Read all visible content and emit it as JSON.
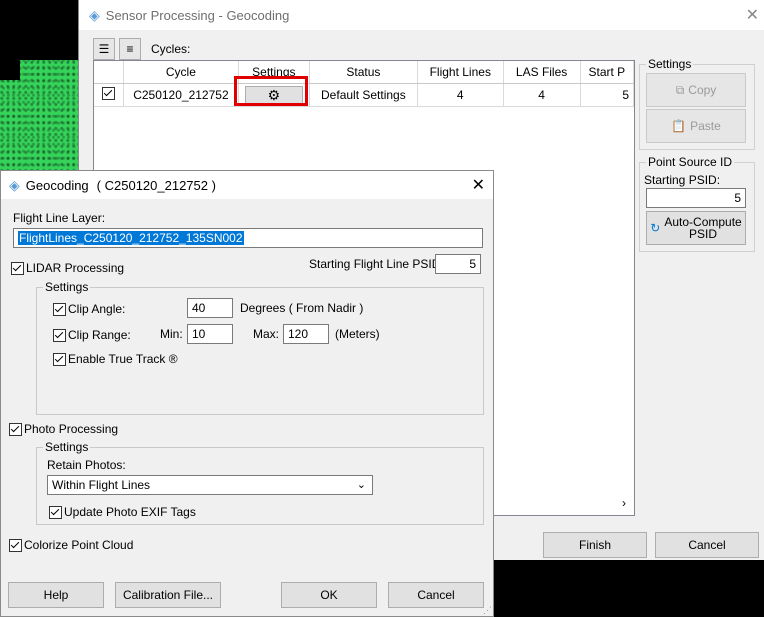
{
  "back_window": {
    "title": "Sensor Processing - Geocoding",
    "toolbar": {
      "list_icon": "☰",
      "menu_icon": "≡",
      "cycles_label": "Cycles:"
    },
    "table": {
      "columns": [
        "Cycle",
        "Settings",
        "Status",
        "Flight Lines",
        "LAS Files",
        "Start P"
      ],
      "rows": [
        {
          "checked": true,
          "cycle": "C250120_212752",
          "settings_icon": "gear-icon",
          "status": "Default Settings",
          "flight_lines": "4",
          "las_files": "4",
          "start": "5"
        }
      ]
    },
    "settings_group": {
      "title": "Settings",
      "copy": "Copy",
      "paste": "Paste"
    },
    "psid_group": {
      "title": "Point Source ID",
      "starting_psid_label": "Starting PSID:",
      "starting_psid_value": "5",
      "auto_compute": "Auto-Compute\nPSID"
    },
    "buttons": {
      "finish": "Finish",
      "cancel": "Cancel"
    }
  },
  "dialog": {
    "title": "Geocoding",
    "cycle": "( C250120_212752 )",
    "flight_line_layer_label": "Flight Line Layer:",
    "flight_line_layer_value": "FlightLines_C250120_212752_135SN002",
    "lidar_processing": {
      "label": "LIDAR Processing",
      "checked": true
    },
    "starting_flight_line_psid_label": "Starting Flight Line PSID:",
    "starting_flight_line_psid_value": "5",
    "lidar_settings": {
      "title": "Settings",
      "clip_angle_label": "Clip Angle:",
      "clip_angle_value": "40",
      "clip_angle_units": "Degrees ( From Nadir )",
      "clip_range_label": "Clip Range:",
      "min_label": "Min:",
      "min_value": "10",
      "max_label": "Max:",
      "max_value": "120",
      "range_units": "(Meters)",
      "true_track_label": "Enable True Track ®"
    },
    "photo_processing": {
      "label": "Photo Processing",
      "checked": true
    },
    "photo_settings": {
      "title": "Settings",
      "retain_photos_label": "Retain Photos:",
      "retain_photos_value": "Within Flight Lines",
      "update_exif_label": "Update Photo EXIF Tags"
    },
    "colorize_label": "Colorize Point Cloud",
    "buttons": {
      "help": "Help",
      "calibration": "Calibration File...",
      "ok": "OK",
      "cancel": "Cancel"
    }
  },
  "colors": {
    "accent": "#0078d7",
    "highlight_box": "#e00000",
    "point_cloud": "#35d35a"
  }
}
